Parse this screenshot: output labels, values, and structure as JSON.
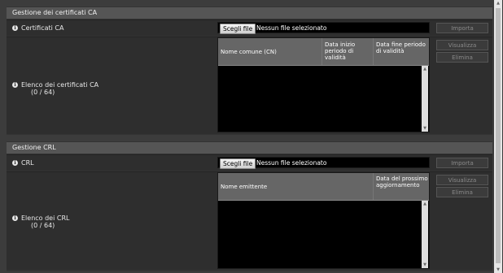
{
  "ca": {
    "header": "Gestione dei certificati CA",
    "file_row_label": "Certificati CA",
    "choose_file": "Scegli file",
    "no_file": "Nessun file selezionato",
    "import_label": "Importa",
    "list_label_line1": "Elenco dei certificati CA",
    "list_label_line2": "(0 / 64)",
    "columns": [
      "Nome comune (CN)",
      "Data inizio periodo di validità",
      "Data fine periodo di validità"
    ],
    "view_label": "Visualizza",
    "delete_label": "Elimina"
  },
  "crl": {
    "header": "Gestione CRL",
    "file_row_label": "CRL",
    "choose_file": "Scegli file",
    "no_file": "Nessun file selezionato",
    "import_label": "Importa",
    "list_label_line1": "Elenco dei CRL",
    "list_label_line2": "(0 / 64)",
    "columns": [
      "Nome emittente",
      "Data del prossimo aggiornamento"
    ],
    "view_label": "Visualizza",
    "delete_label": "Elimina"
  },
  "colors": {
    "background": "#3c3c3c",
    "header": "#555555",
    "row": "#2e2e2e",
    "list": "#000000"
  }
}
